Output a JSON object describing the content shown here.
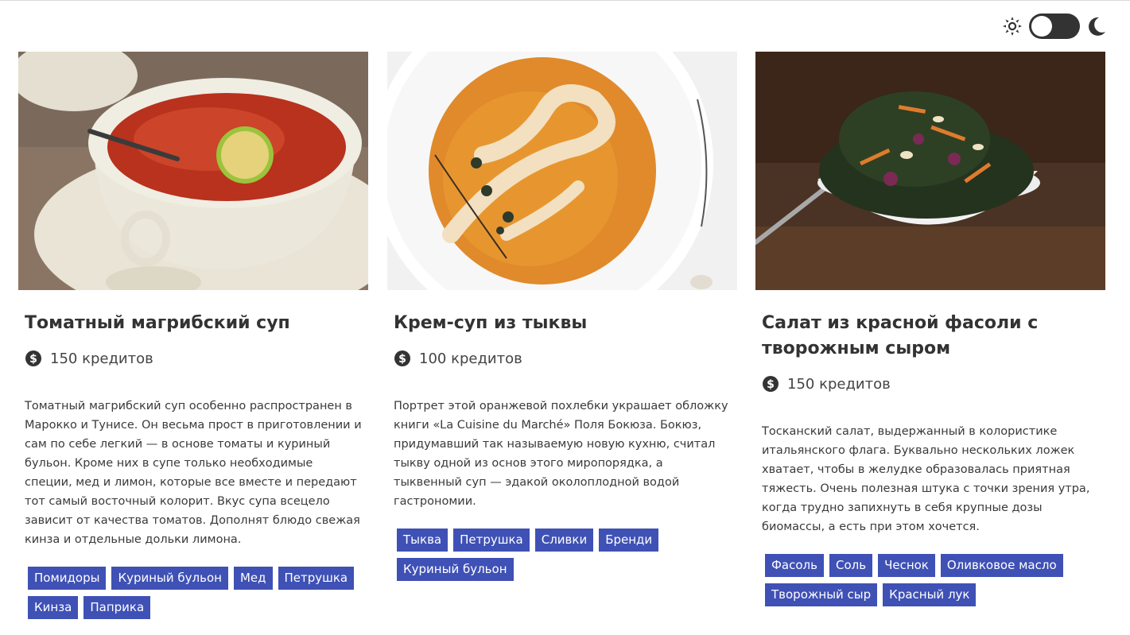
{
  "theme_toggle": {
    "mode": "light",
    "left_icon": "sun-icon",
    "right_icon": "moon-icon"
  },
  "colors": {
    "tag_bg": "#3f51b5",
    "tag_text": "#ffffff",
    "switch_bg": "#333333"
  },
  "cards": [
    {
      "title": "Томатный магрибский суп",
      "price": "150 кредитов",
      "description": "Томатный магрибский суп особенно распространен в Марокко и Тунисе. Он весьма прост в приготовлении и сам по себе легкий — в основе томаты и куриный бульон. Кроме них в супе только необходимые специи, мед и лимон, которые все вместе и передают тот самый восточный колорит. Вкус супа всецело зависит от качества томатов. Дополнят блюдо свежая кинза и отдельные дольки лимона.",
      "tags": [
        "Помидоры",
        "Куриный бульон",
        "Мед",
        "Петрушка",
        "Кинза",
        "Паприка"
      ]
    },
    {
      "title": "Крем-суп из тыквы",
      "price": "100 кредитов",
      "description": "Портрет этой оранжевой похлебки украшает обложку книги «La Cuisine du Marché» Поля Бокюза. Бокюз, придумавший так называемую новую кухню, считал тыкву одной из основ этого миропорядка, а тыквенный суп — эдакой околоплодной водой гастрономии.",
      "tags": [
        "Тыква",
        "Петрушка",
        "Сливки",
        "Бренди",
        "Куриный бульон"
      ]
    },
    {
      "title": "Салат из красной фасоли с творожным сыром",
      "price": "150 кредитов",
      "description": "Тосканский салат, выдержанный в колористике итальянского флага. Буквально нескольких ложек хватает, чтобы в желудке образовалась приятная тяжесть. Очень полезная штука с точки зрения утра, когда трудно запихнуть в себя крупные дозы биомассы, а есть при этом хочется.",
      "tags": [
        "Фасоль",
        "Соль",
        "Чеснок",
        "Оливковое масло",
        "Творожный сыр",
        "Красный лук"
      ]
    }
  ]
}
